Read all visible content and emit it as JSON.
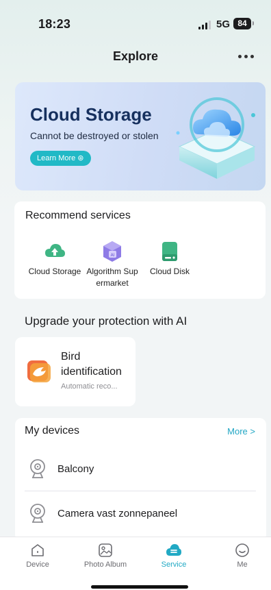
{
  "status": {
    "time": "18:23",
    "network": "5G",
    "battery": "84"
  },
  "header": {
    "title": "Explore"
  },
  "banner": {
    "title": "Cloud Storage",
    "subtitle": "Cannot be destroyed or stolen",
    "button_label": "Learn More ⊛"
  },
  "recommend": {
    "title": "Recommend services",
    "items": [
      {
        "label": "Cloud Storage",
        "icon": "cloud-upload-icon"
      },
      {
        "label": "Algorithm Sup ermarket",
        "icon": "ai-cube-icon"
      },
      {
        "label": "Cloud Disk",
        "icon": "disk-icon"
      }
    ]
  },
  "upgrade": {
    "title": "Upgrade your protection with AI",
    "card": {
      "name": "Bird identification",
      "description": "Automatic reco..."
    }
  },
  "devices": {
    "title": "My devices",
    "more_label": "More >",
    "items": [
      {
        "name": "Balcony"
      },
      {
        "name": "Camera vast zonnepaneel"
      }
    ]
  },
  "tabs": [
    {
      "label": "Device",
      "icon": "home-icon"
    },
    {
      "label": "Photo Album",
      "icon": "photo-icon"
    },
    {
      "label": "Service",
      "icon": "service-icon",
      "active": true
    },
    {
      "label": "Me",
      "icon": "smile-icon"
    }
  ],
  "colors": {
    "accent": "#21a9c4",
    "banner_button": "#21b9c6",
    "service_green": "#3fb584",
    "ai_purple": "#8e7be6"
  }
}
